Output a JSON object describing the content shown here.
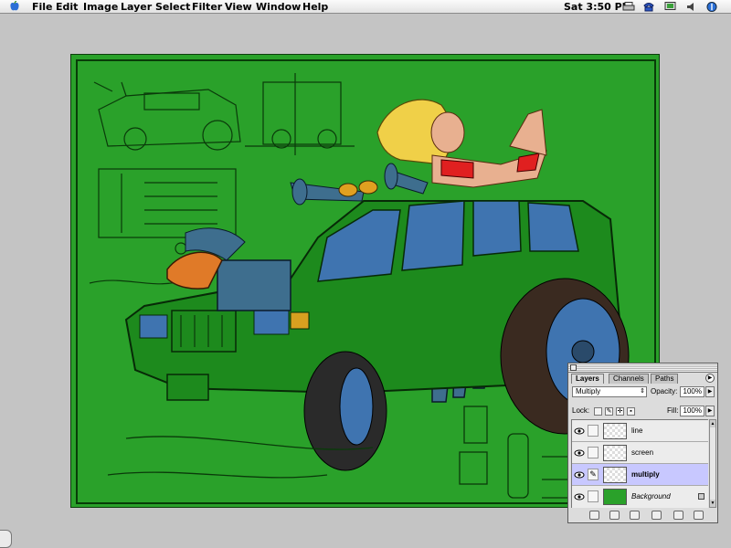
{
  "menubar": {
    "apple_icon": "apple-logo",
    "items": [
      "File",
      "Edit",
      "Image",
      "Layer",
      "Select",
      "Filter",
      "View",
      "Window",
      "Help"
    ],
    "clock": "Sat 3:50 PM",
    "status_icons": [
      "printer-icon",
      "phone-icon",
      "monitor-icon",
      "speaker-icon",
      "application-icon"
    ]
  },
  "canvas": {
    "background_color": "#2aa12a",
    "artwork": "hot-rod-illustration"
  },
  "layers_palette": {
    "tabs": [
      "Layers",
      "Channels",
      "Paths"
    ],
    "active_tab": "Layers",
    "blend_mode": "Multiply",
    "opacity_label": "Opacity:",
    "opacity_value": "100%",
    "lock_label": "Lock:",
    "fill_label": "Fill:",
    "fill_value": "100%",
    "layers": [
      {
        "name": "line",
        "visible": true,
        "selected": false
      },
      {
        "name": "screen",
        "visible": true,
        "selected": false
      },
      {
        "name": "multiply",
        "visible": true,
        "selected": true
      },
      {
        "name": "Background",
        "visible": true,
        "selected": false,
        "locked": true
      }
    ],
    "bottom_icons": [
      "layer-style-icon",
      "mask-icon",
      "new-set-icon",
      "adjustment-layer-icon",
      "new-layer-icon",
      "trash-icon"
    ]
  }
}
